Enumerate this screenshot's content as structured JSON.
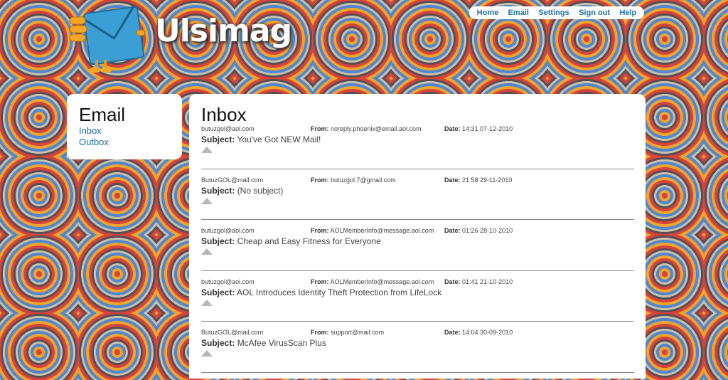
{
  "brand": {
    "name": "Ulsimag",
    "logo_icon": "envelope-mascot-icon"
  },
  "nav": [
    "Home",
    "Email",
    "Settings",
    "Sign out",
    "Help"
  ],
  "sidebar": {
    "title": "Email",
    "links": [
      "Inbox",
      "Outbox"
    ]
  },
  "inbox": {
    "title": "Inbox",
    "from_label": "From:",
    "date_label": "Date:",
    "subject_label": "Subject:",
    "expand_icon": "triangle-up-icon",
    "messages": [
      {
        "to": "butuzgol@aol.com",
        "from": "noreply.phoenix@email.aol.com",
        "date": "14:31 07-12-2010",
        "subject": "You've Got NEW Mail!"
      },
      {
        "to": "ButuzGOL@mail.com",
        "from": "butuzgol.7@gmail.com",
        "date": "21:58 29-11-2010",
        "subject": "(No subject)"
      },
      {
        "to": "butuzgol@aol.com",
        "from": "AOLMemberInfo@message.aol.com",
        "date": "01:26 28-10-2010",
        "subject": "Cheap and Easy Fitness for Everyone"
      },
      {
        "to": "butuzgol@aol.com",
        "from": "AOLMemberInfo@message.aol.com",
        "date": "01:41 21-10-2010",
        "subject": "AOL Introduces Identity Theft Protection from LifeLock"
      },
      {
        "to": "ButuzGOL@mail.com",
        "from": "support@mail.com",
        "date": "14:04 30-09-2010",
        "subject": "McAfee VirusScan Plus"
      }
    ]
  }
}
